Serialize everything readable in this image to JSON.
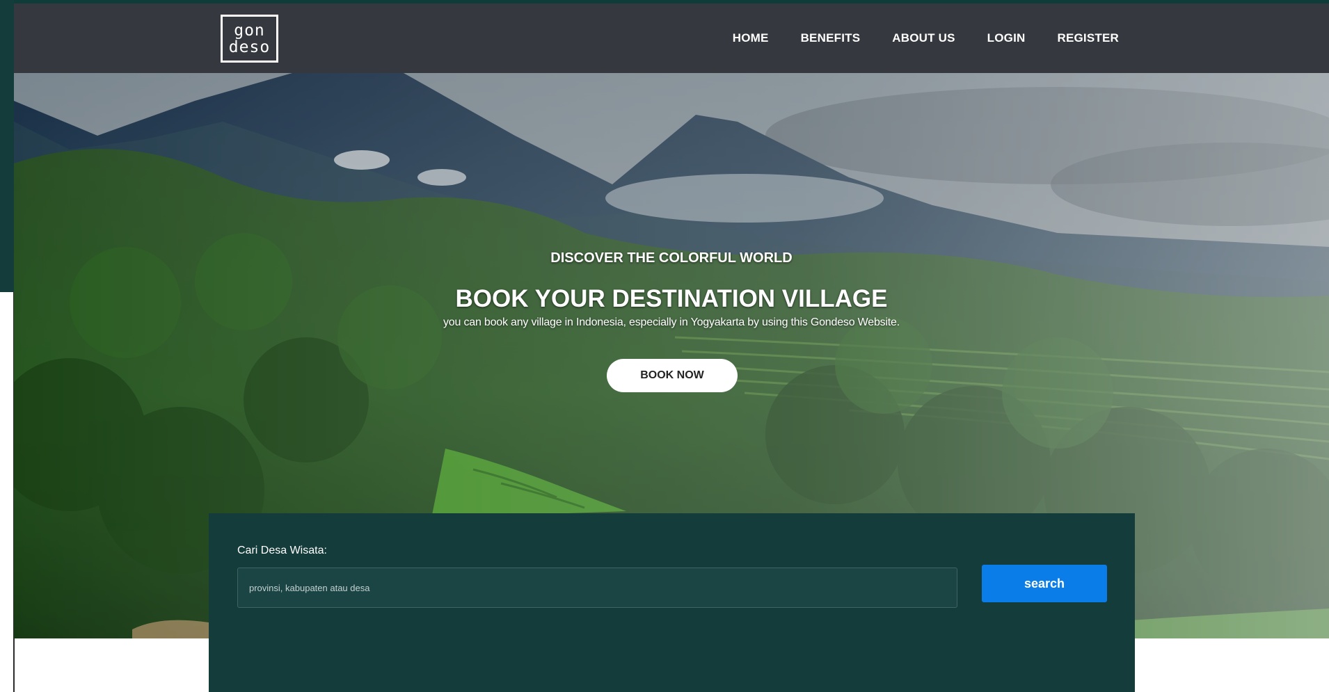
{
  "brand": {
    "logo_line1": "gon",
    "logo_line2": "deso"
  },
  "nav": {
    "items": [
      {
        "label": "HOME"
      },
      {
        "label": "BENEFITS"
      },
      {
        "label": "ABOUT US"
      },
      {
        "label": "LOGIN"
      },
      {
        "label": "REGISTER"
      }
    ]
  },
  "hero": {
    "subtitle": "DISCOVER THE COLORFUL WORLD",
    "title": "BOOK YOUR DESTINATION VILLAGE",
    "description": "you can book any village in Indonesia, especially in Yogyakarta by using this Gondeso Website.",
    "cta_label": "BOOK NOW"
  },
  "search": {
    "label": "Cari Desa Wisata:",
    "placeholder": "provinsi, kabupaten atau desa",
    "value": "",
    "button_label": "search"
  },
  "colors": {
    "nav_bg": "#35393f",
    "panel_bg": "#143c3a",
    "accent_blue": "#0b7de8",
    "text_light": "#ffffff"
  }
}
